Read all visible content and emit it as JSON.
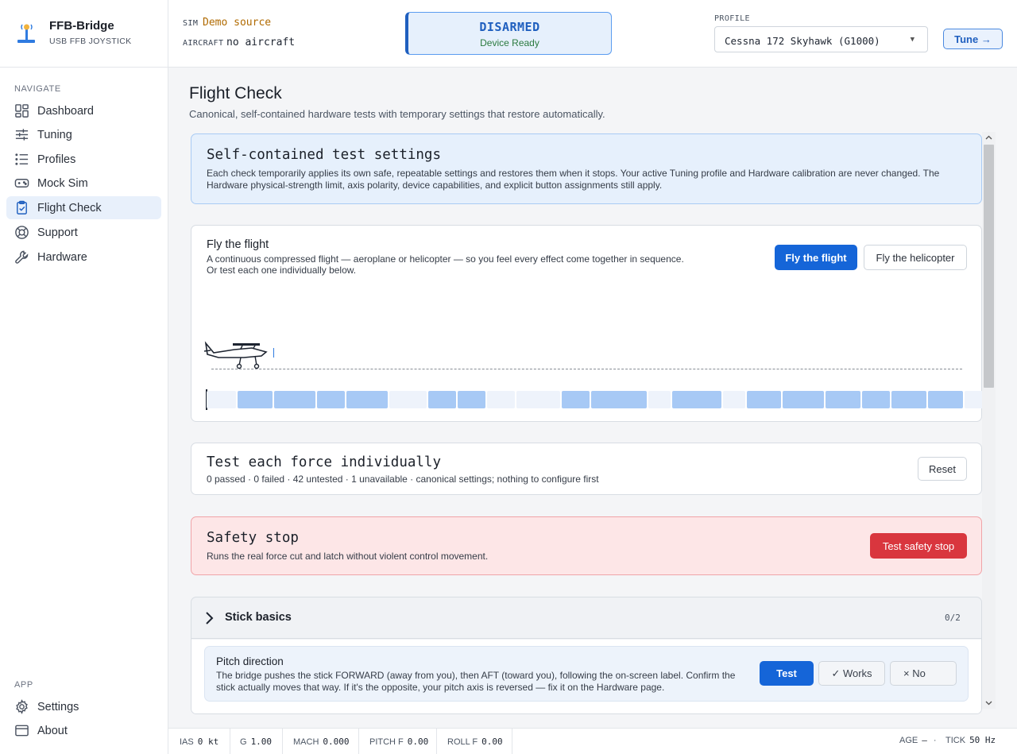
{
  "brand": {
    "name": "FFB-Bridge",
    "subtitle": "USB FFB JOYSTICK"
  },
  "nav": {
    "section_label": "NAVIGATE",
    "items": [
      {
        "label": "Dashboard",
        "icon": "dashboard-icon"
      },
      {
        "label": "Tuning",
        "icon": "sliders-icon"
      },
      {
        "label": "Profiles",
        "icon": "list-icon"
      },
      {
        "label": "Mock Sim",
        "icon": "gamepad-icon"
      },
      {
        "label": "Flight Check",
        "icon": "clipboard-check-icon",
        "active": true
      },
      {
        "label": "Support",
        "icon": "lifebuoy-icon"
      },
      {
        "label": "Hardware",
        "icon": "wrench-icon"
      }
    ]
  },
  "app_nav": {
    "section_label": "APP",
    "items": [
      {
        "label": "Settings",
        "icon": "gear-icon"
      },
      {
        "label": "About",
        "icon": "window-icon"
      }
    ]
  },
  "topbar": {
    "sim_label": "SIM",
    "sim_value": "Demo source",
    "aircraft_label": "AIRCRAFT",
    "aircraft_value": "no aircraft",
    "arm_state": "DISARMED",
    "device_state": "Device Ready",
    "profile_label": "PROFILE",
    "profile_value": "Cessna 172 Skyhawk (G1000)",
    "tune_label": "Tune →"
  },
  "page": {
    "title": "Flight Check",
    "subtitle": "Canonical, self-contained hardware tests with temporary settings that restore automatically."
  },
  "settings_card": {
    "title": "Self-contained test settings",
    "body": "Each check temporarily applies its own safe, repeatable settings and restores them when it stops. Your active Tuning profile and Hardware calibration are never changed. The Hardware physical-strength limit, axis polarity, device capabilities, and explicit button assignments still apply."
  },
  "flight_card": {
    "title": "Fly the flight",
    "body_line1": "A continuous compressed flight — aeroplane or helicopter — so you feel every effect come together in sequence.",
    "body_line2": "Or test each one individually below.",
    "fly_flight_btn": "Fly the flight",
    "fly_heli_btn": "Fly the helicopter",
    "timeline_segments": [
      {
        "w": 37,
        "on": false
      },
      {
        "w": 44,
        "on": true
      },
      {
        "w": 52,
        "on": true
      },
      {
        "w": 35,
        "on": true
      },
      {
        "w": 52,
        "on": true
      },
      {
        "w": 47,
        "on": false
      },
      {
        "w": 35,
        "on": true
      },
      {
        "w": 35,
        "on": true
      },
      {
        "w": 35,
        "on": false
      },
      {
        "w": 55,
        "on": false
      },
      {
        "w": 35,
        "on": true
      },
      {
        "w": 70,
        "on": true
      },
      {
        "w": 28,
        "on": false
      },
      {
        "w": 62,
        "on": true
      },
      {
        "w": 28,
        "on": false
      },
      {
        "w": 43,
        "on": true
      },
      {
        "w": 52,
        "on": true
      },
      {
        "w": 44,
        "on": true
      },
      {
        "w": 35,
        "on": true
      },
      {
        "w": 44,
        "on": true
      },
      {
        "w": 44,
        "on": true
      },
      {
        "w": 36,
        "on": false
      }
    ]
  },
  "individual_card": {
    "title": "Test each force individually",
    "summary": "0 passed · 0 failed · 42 untested · 1 unavailable · canonical settings; nothing to configure first",
    "reset_btn": "Reset"
  },
  "safety_card": {
    "title": "Safety stop",
    "body": "Runs the real force cut and latch without violent control movement.",
    "btn": "Test safety stop"
  },
  "group": {
    "title": "Stick basics",
    "count": "0/2"
  },
  "test_item": {
    "title": "Pitch direction",
    "desc": "The bridge pushes the stick FORWARD (away from you), then AFT (toward you), following the on-screen label. Confirm the stick actually moves that way. If it's the opposite, your pitch axis is reversed — fix it on the Hardware page.",
    "test_btn": "Test",
    "works_btn": "✓ Works",
    "no_btn": "× No"
  },
  "statusbar": {
    "ias_label": "IAS",
    "ias_value": "0 kt",
    "g_label": "G",
    "g_value": "1.00",
    "mach_label": "MACH",
    "mach_value": "0.000",
    "pitchf_label": "PITCH F",
    "pitchf_value": "0.00",
    "rollf_label": "ROLL F",
    "rollf_value": "0.00",
    "age_label": "AGE",
    "age_value": "—",
    "dot": "·",
    "tick_label": "TICK",
    "tick_value": "50 Hz"
  },
  "colors": {
    "accent": "#1565d8",
    "danger": "#d9363e",
    "danger_bg": "#fde6e7",
    "info_bg": "#e6f0fc"
  }
}
